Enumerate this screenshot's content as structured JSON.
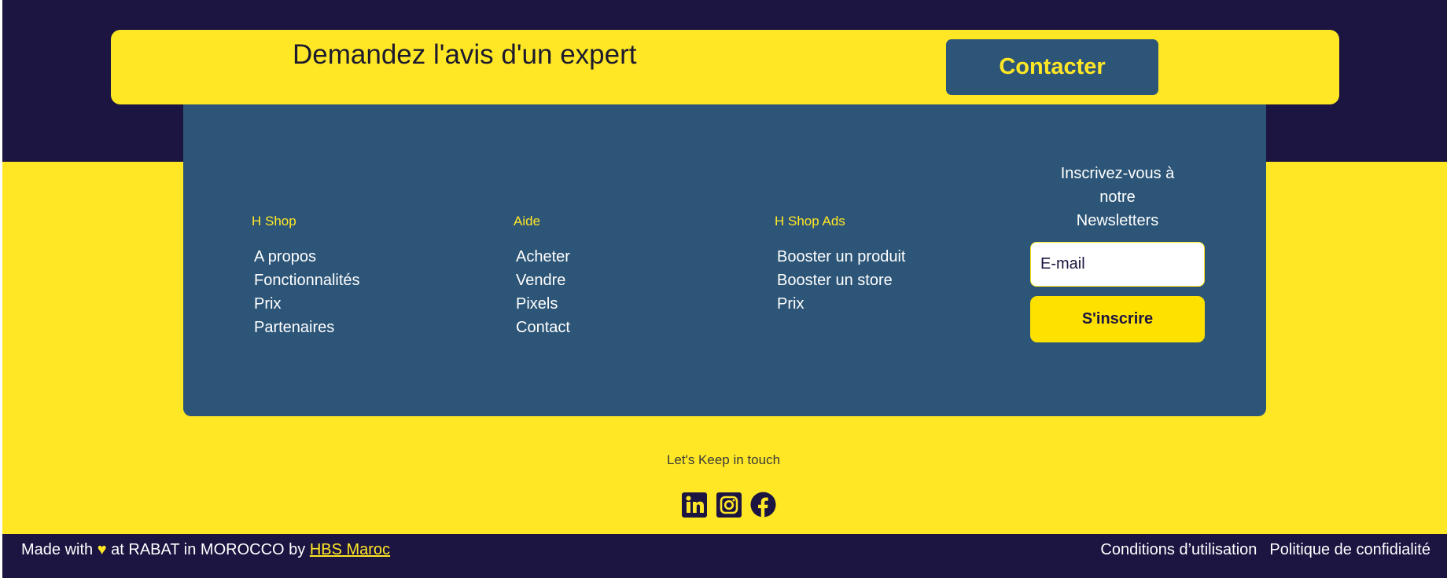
{
  "expert_banner": {
    "text": "Demandez l'avis d'un expert",
    "button_label": "Contacter"
  },
  "footer": {
    "columns": [
      {
        "title": "H Shop",
        "links": [
          "A propos",
          "Fonctionnalités",
          "Prix",
          "Partenaires"
        ]
      },
      {
        "title": "Aide",
        "links": [
          "Acheter",
          "Vendre",
          "Pixels",
          "Contact"
        ]
      },
      {
        "title": "H Shop Ads",
        "links": [
          "Booster un produit",
          "Booster un store",
          "Prix"
        ]
      }
    ],
    "newsletter": {
      "title_lines": [
        "Inscrivez-vous à",
        "notre",
        "Newsletters"
      ],
      "email_placeholder": "E-mail",
      "subscribe_label": "S'inscrire"
    }
  },
  "keep_in_touch": {
    "label": "Let's Keep in touch",
    "socials": [
      "linkedin-icon",
      "instagram-icon",
      "facebook-icon"
    ]
  },
  "bottom_bar": {
    "made_with_prefix": "Made with",
    "heart": "♥",
    "made_with_middle": "at RABAT in MOROCCO by",
    "company_link": "HBS Maroc",
    "terms_link": "Conditions d’utilisation",
    "privacy_link": "Politique de confidialité"
  },
  "colors": {
    "navy": "#1c1441",
    "yellow": "#ffe726",
    "panel_blue": "#2d5577"
  }
}
